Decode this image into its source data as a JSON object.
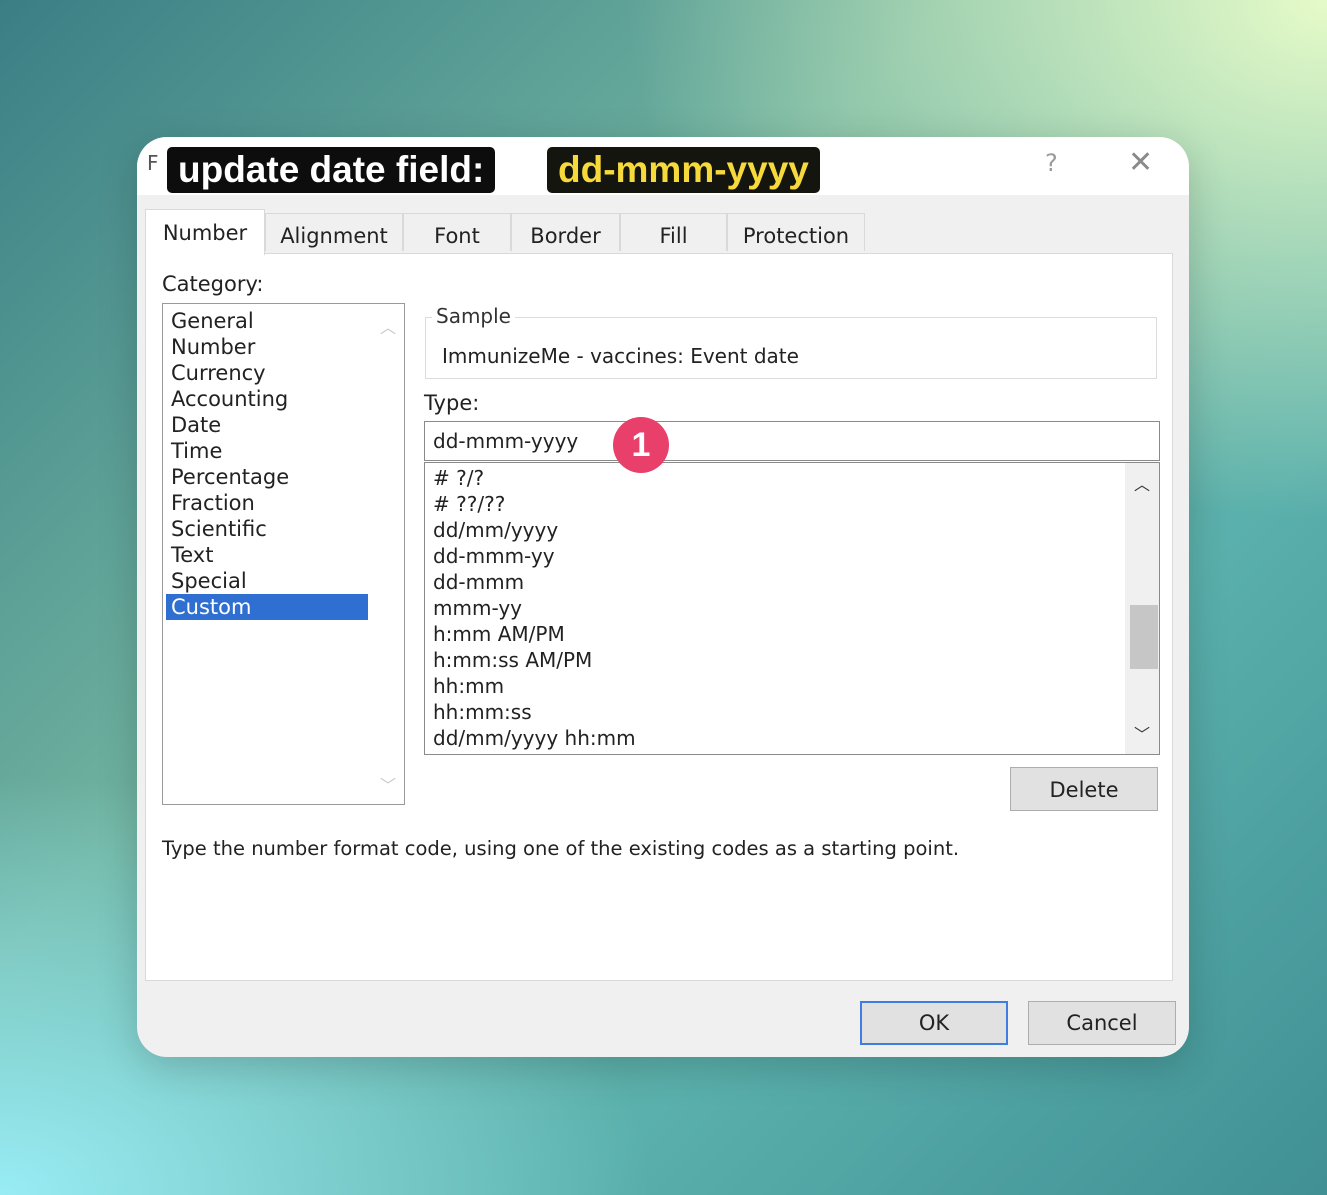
{
  "window": {
    "title_partial": "F",
    "help_glyph": "?",
    "close_glyph": "✕"
  },
  "callouts": {
    "instruction": "update date field:",
    "format_code": "dd-mmm-yyyy",
    "step_badge": "1",
    "badge_color": "#e83f6b",
    "format_code_color": "#f6d93a"
  },
  "tabs": [
    {
      "label": "Number",
      "active": true
    },
    {
      "label": "Alignment",
      "active": false
    },
    {
      "label": "Font",
      "active": false
    },
    {
      "label": "Border",
      "active": false
    },
    {
      "label": "Fill",
      "active": false
    },
    {
      "label": "Protection",
      "active": false
    }
  ],
  "category": {
    "label": "Category:",
    "items": [
      "General",
      "Number",
      "Currency",
      "Accounting",
      "Date",
      "Time",
      "Percentage",
      "Fraction",
      "Scientific",
      "Text",
      "Special",
      "Custom"
    ],
    "selected": "Custom",
    "selected_color": "#2e6fd1"
  },
  "sample": {
    "legend": "Sample",
    "value": "ImmunizeMe - vaccines: Event date"
  },
  "type": {
    "label": "Type:",
    "value": "dd-mmm-yyyy",
    "formats": [
      "# ?/?",
      "# ??/??",
      "dd/mm/yyyy",
      "dd-mmm-yy",
      "dd-mmm",
      "mmm-yy",
      "h:mm AM/PM",
      "h:mm:ss AM/PM",
      "hh:mm",
      "hh:mm:ss",
      "dd/mm/yyyy hh:mm"
    ]
  },
  "buttons": {
    "delete": "Delete",
    "ok": "OK",
    "cancel": "Cancel"
  },
  "hint": "Type the number format code, using one of the existing codes as a starting point.",
  "icons": {
    "scroll_up": "chevron-up-icon",
    "scroll_down": "chevron-down-icon"
  }
}
